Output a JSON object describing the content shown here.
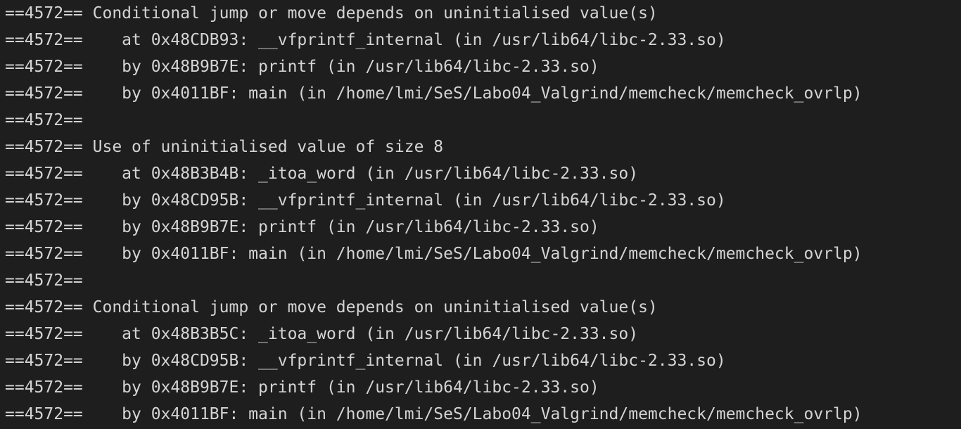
{
  "terminal": {
    "lines": [
      "==4572== Conditional jump or move depends on uninitialised value(s)",
      "==4572==    at 0x48CDB93: __vfprintf_internal (in /usr/lib64/libc-2.33.so)",
      "==4572==    by 0x48B9B7E: printf (in /usr/lib64/libc-2.33.so)",
      "==4572==    by 0x4011BF: main (in /home/lmi/SeS/Labo04_Valgrind/memcheck/memcheck_ovrlp)",
      "==4572==",
      "==4572== Use of uninitialised value of size 8",
      "==4572==    at 0x48B3B4B: _itoa_word (in /usr/lib64/libc-2.33.so)",
      "==4572==    by 0x48CD95B: __vfprintf_internal (in /usr/lib64/libc-2.33.so)",
      "==4572==    by 0x48B9B7E: printf (in /usr/lib64/libc-2.33.so)",
      "==4572==    by 0x4011BF: main (in /home/lmi/SeS/Labo04_Valgrind/memcheck/memcheck_ovrlp)",
      "==4572==",
      "==4572== Conditional jump or move depends on uninitialised value(s)",
      "==4572==    at 0x48B3B5C: _itoa_word (in /usr/lib64/libc-2.33.so)",
      "==4572==    by 0x48CD95B: __vfprintf_internal (in /usr/lib64/libc-2.33.so)",
      "==4572==    by 0x48B9B7E: printf (in /usr/lib64/libc-2.33.so)",
      "==4572==    by 0x4011BF: main (in /home/lmi/SeS/Labo04_Valgrind/memcheck/memcheck_ovrlp)"
    ]
  },
  "colors": {
    "background": "#1e1e1e",
    "text": "#d4d4d4"
  }
}
